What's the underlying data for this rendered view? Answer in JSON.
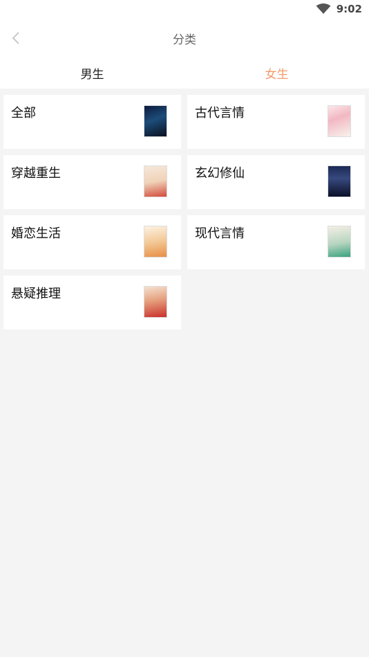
{
  "status_bar": {
    "time": "9:02",
    "wifi_icon": "wifi-icon"
  },
  "header": {
    "title": "分类",
    "back_icon": "chevron-left-icon"
  },
  "tabs": [
    {
      "label": "男生",
      "active": false
    },
    {
      "label": "女生",
      "active": true
    }
  ],
  "accent_color": "#f39b6a",
  "categories": [
    {
      "label": "全部",
      "cover": "book-cover-image"
    },
    {
      "label": "古代言情",
      "cover": "book-cover-image"
    },
    {
      "label": "穿越重生",
      "cover": "book-cover-image"
    },
    {
      "label": "玄幻修仙",
      "cover": "book-cover-image"
    },
    {
      "label": "婚恋生活",
      "cover": "book-cover-image"
    },
    {
      "label": "现代言情",
      "cover": "book-cover-image"
    },
    {
      "label": "悬疑推理",
      "cover": "book-cover-image"
    }
  ]
}
